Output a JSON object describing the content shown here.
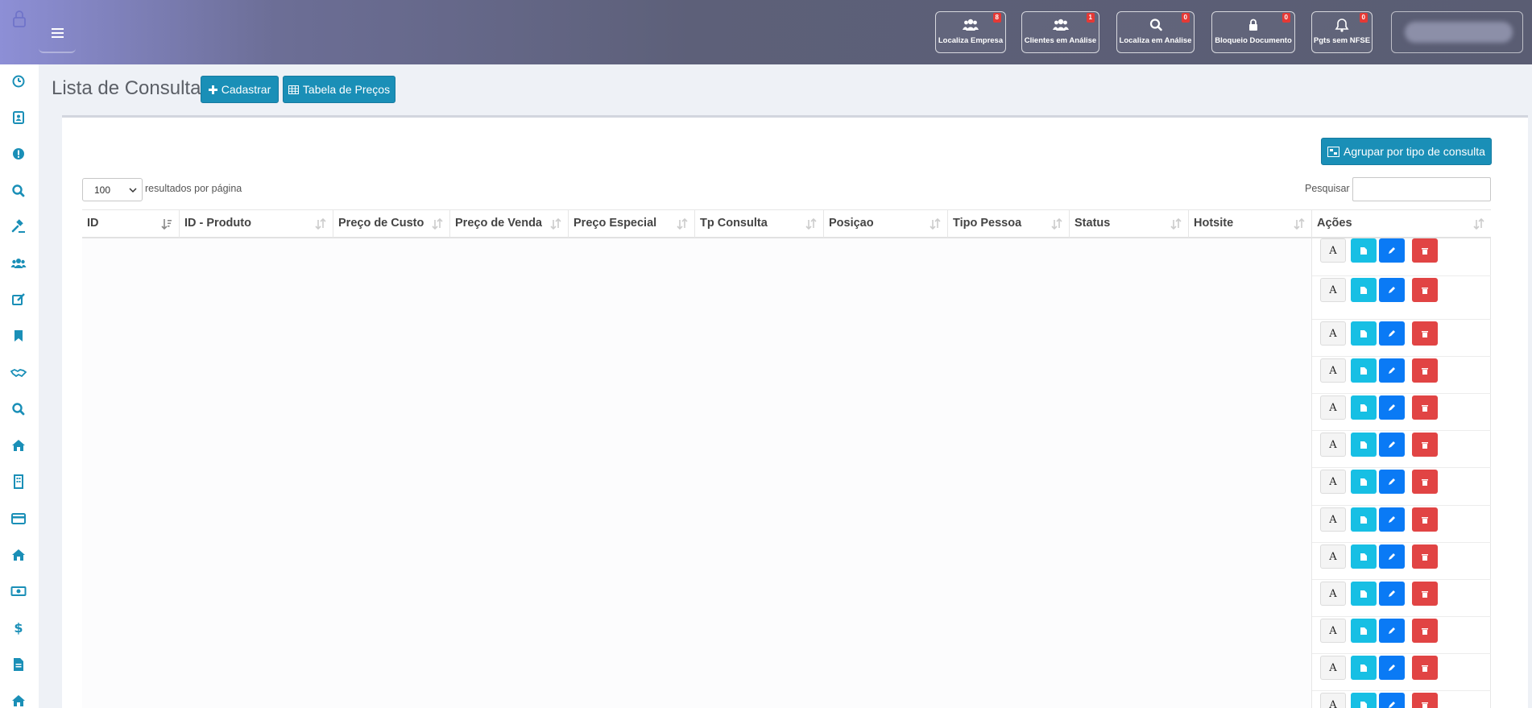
{
  "header": {
    "buttons": [
      {
        "label": "Localiza Empresa",
        "badge": "8",
        "icon": "users-icon"
      },
      {
        "label": "Clientes em Análise",
        "badge": "1",
        "icon": "users-icon"
      },
      {
        "label": "Localiza em Análise",
        "badge": "0",
        "icon": "search-icon"
      },
      {
        "label": "Bloqueio Documento",
        "badge": "0",
        "icon": "lock-icon"
      },
      {
        "label": "Pgts sem NFSE",
        "badge": "0",
        "icon": "bell-icon"
      }
    ]
  },
  "sidebar": {
    "icons": [
      "dashboard-icon",
      "contact-card-icon",
      "alert-icon",
      "search-icon",
      "gavel-icon",
      "users-icon",
      "edit-icon",
      "bookmark-icon",
      "handshake-icon",
      "search-icon",
      "home-icon",
      "building-icon",
      "credit-card-icon",
      "home-icon",
      "money-icon",
      "dollar-icon",
      "file-icon"
    ]
  },
  "page": {
    "title": "Lista de Consultas",
    "cadastrar_label": "Cadastrar",
    "tabela_label": "Tabela de Preços",
    "agrupar_label": "Agrupar por tipo de consulta"
  },
  "table": {
    "page_length": "100",
    "length_label": "resultados por página",
    "search_label": "Pesquisar",
    "columns": [
      "ID",
      "ID - Produto",
      "Preço de Custo",
      "Preço de Venda",
      "Preço Especial",
      "Tp Consulta",
      "Posiçao",
      "Tipo Pessoa",
      "Status",
      "Hotsite",
      "Ações"
    ],
    "action_a_label": "A",
    "row_count_visible": 13
  },
  "colors": {
    "info": "#1a8fb7",
    "cyan": "#17bfe4",
    "primary": "#0a7af5",
    "danger": "#e14444",
    "badge": "#e53935"
  }
}
